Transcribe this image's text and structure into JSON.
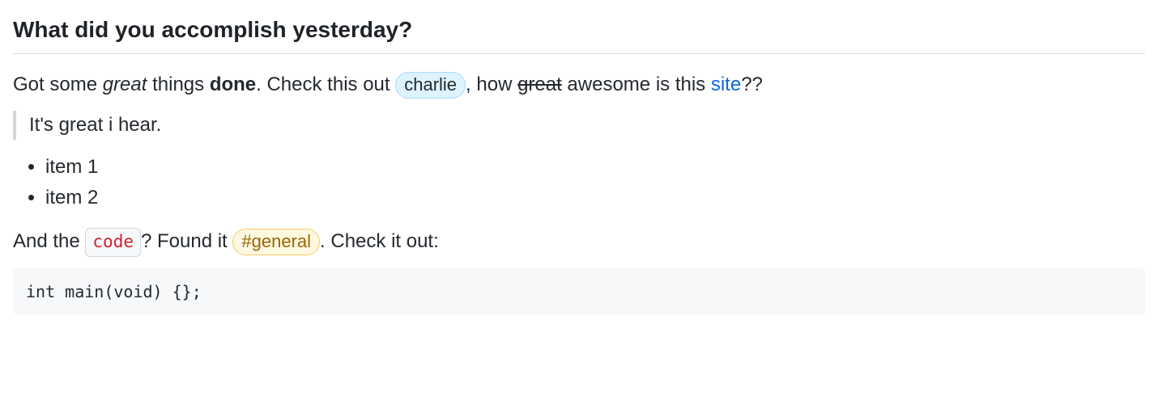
{
  "heading": "What did you accomplish yesterday?",
  "p1": {
    "part1": "Got some ",
    "italic": "great",
    "part2": " things ",
    "bold": "done",
    "part3": ". Check this out ",
    "mention": "charlie",
    "part4": ", how ",
    "strike": "great",
    "part5": " awesome is this ",
    "link": "site",
    "part6": "??"
  },
  "blockquote": "It's great i hear.",
  "list": {
    "item1": "item 1",
    "item2": "item 2"
  },
  "p2": {
    "part1": "And the ",
    "code": "code",
    "part2": "? Found it ",
    "channel": "#general",
    "part3": ". Check it out:"
  },
  "codeblock": "int main(void) {};"
}
